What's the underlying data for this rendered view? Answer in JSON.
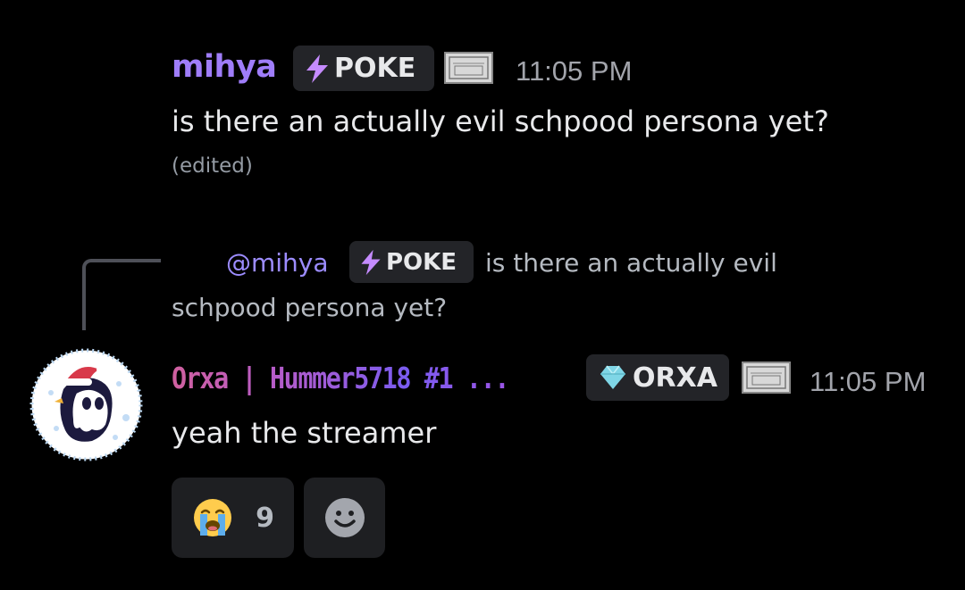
{
  "colors": {
    "background": "#000000",
    "username_mihya": "#9f7dfa",
    "username_orxa_start": "#d0609f",
    "username_orxa_end": "#7a5cf0",
    "mention": "#9c8cff",
    "timestamp": "#a2a4ab",
    "tag_bg": "#232428",
    "poke_bolt": "#c58bff",
    "orxa_gem": "#7fd6e6"
  },
  "message1": {
    "username": "mihya",
    "tag_icon": "lightning-bolt-icon",
    "tag_label": "POKE",
    "badge_icon": "admit-one-ticket-icon",
    "timestamp": "11:05 PM",
    "text": "is there an actually evil schpood persona yet?",
    "edited_label": "(edited)"
  },
  "reply": {
    "mention": "@mihya",
    "tag_icon": "lightning-bolt-icon",
    "tag_label": "POKE",
    "preview_line1": "is there an actually evil",
    "preview_line2": "schpood persona yet?"
  },
  "message2": {
    "username": "Orxa | Hummer5718 #1 ...",
    "tag_icon": "gem-icon",
    "tag_label": "ORXA",
    "badge_icon": "admit-one-ticket-icon",
    "timestamp": "11:05 PM",
    "text": "yeah the streamer",
    "avatar_icon": "penguin-santa-hat-avatar"
  },
  "reactions": [
    {
      "emoji_icon": "loudly-crying-face-icon",
      "count": "9"
    },
    {
      "emoji_icon": "add-reaction-smiley-icon",
      "count": ""
    }
  ]
}
